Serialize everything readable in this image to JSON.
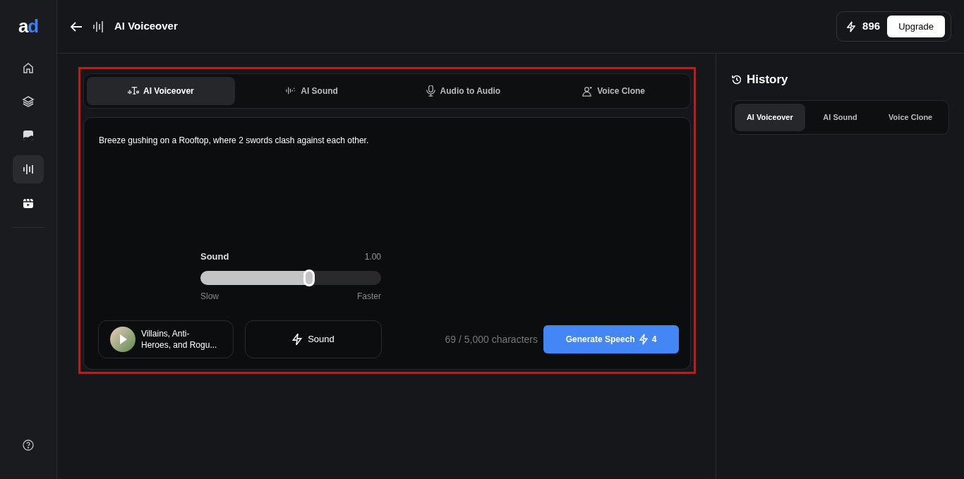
{
  "logo": {
    "part_1": "a",
    "part_2": "d"
  },
  "sidebar": {
    "items": [
      {
        "kind": "home",
        "selected": false
      },
      {
        "kind": "layers",
        "selected": false
      },
      {
        "kind": "image",
        "selected": false
      },
      {
        "kind": "audio",
        "selected": true
      },
      {
        "kind": "video",
        "selected": false
      }
    ]
  },
  "header": {
    "title": "AI Voiceover",
    "credits": "896",
    "upgrade": "Upgrade"
  },
  "tabs": [
    {
      "label": "AI Voiceover",
      "kind": "voiceover",
      "selected": true
    },
    {
      "label": "AI Sound",
      "kind": "sound",
      "selected": false
    },
    {
      "label": "Audio to Audio",
      "kind": "audio",
      "selected": false
    },
    {
      "label": "Voice Clone",
      "kind": "clone",
      "selected": false
    }
  ],
  "editor": {
    "text": "Breeze gushing on a Rooftop, where 2 swords clash against each other."
  },
  "slider": {
    "label": "Sound",
    "reading": "1.00",
    "level": 0.6,
    "min_label": "Slow",
    "max_label": "Faster"
  },
  "voice": {
    "name": "Villains, Anti-Heroes, and Rogu..."
  },
  "sound_button": "Sound",
  "counter": "69 / 5,000 characters",
  "generate": {
    "label": "Generate Speech",
    "cost": "4"
  },
  "history": {
    "title": "History",
    "tabs": [
      {
        "label": "AI Voiceover",
        "selected": true
      },
      {
        "label": "AI Sound",
        "selected": false
      },
      {
        "label": "Voice Clone",
        "selected": false
      }
    ]
  }
}
